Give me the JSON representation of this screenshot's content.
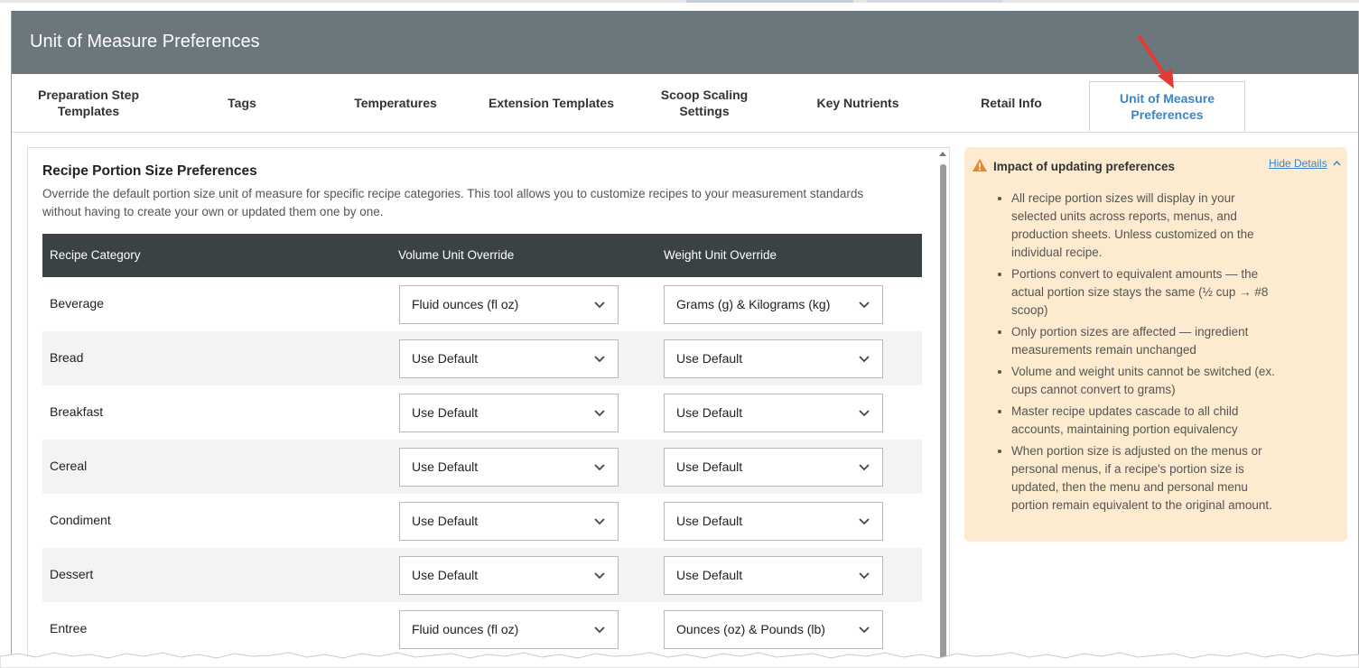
{
  "header": {
    "title": "Unit of Measure Preferences"
  },
  "tabs": [
    {
      "label": "Preparation Step Templates",
      "active": false
    },
    {
      "label": "Tags",
      "active": false
    },
    {
      "label": "Temperatures",
      "active": false
    },
    {
      "label": "Extension Templates",
      "active": false
    },
    {
      "label": "Scoop Scaling Settings",
      "active": false
    },
    {
      "label": "Key Nutrients",
      "active": false
    },
    {
      "label": "Retail Info",
      "active": false
    },
    {
      "label": "Unit of Measure Preferences",
      "active": true
    }
  ],
  "section": {
    "title": "Recipe Portion Size Preferences",
    "description": "Override the default portion size unit of measure for specific recipe categories. This tool allows you to customize recipes to your measurement standards without having to create your own or updated them one by one."
  },
  "table": {
    "columns": [
      "Recipe Category",
      "Volume Unit Override",
      "Weight Unit Override"
    ],
    "rows": [
      {
        "category": "Beverage",
        "volume": "Fluid ounces (fl oz)",
        "weight": "Grams (g) & Kilograms (kg)"
      },
      {
        "category": "Bread",
        "volume": "Use Default",
        "weight": "Use Default"
      },
      {
        "category": "Breakfast",
        "volume": "Use Default",
        "weight": "Use Default"
      },
      {
        "category": "Cereal",
        "volume": "Use Default",
        "weight": "Use Default"
      },
      {
        "category": "Condiment",
        "volume": "Use Default",
        "weight": "Use Default"
      },
      {
        "category": "Dessert",
        "volume": "Use Default",
        "weight": "Use Default"
      },
      {
        "category": "Entree",
        "volume": "Fluid ounces (fl oz)",
        "weight": "Ounces (oz) & Pounds (lb)"
      }
    ]
  },
  "info": {
    "title": "Impact of updating preferences",
    "hide_label": "Hide Details",
    "items": [
      "All recipe portion sizes will display in your selected units across reports, menus, and production sheets. Unless customized on the individual recipe.",
      "Portions convert to equivalent amounts — the actual portion size stays the same (½ cup → #8 scoop)",
      "Only portion sizes are affected — ingredient measurements remain unchanged",
      "Volume and weight units cannot be switched (ex. cups cannot convert to grams)",
      "Master recipe updates cascade to all child accounts, maintaining portion equivalency",
      "When portion size is adjusted on the menus or personal menus, if a recipe's portion size is updated, then the menu and personal menu portion remain equivalent to the original amount."
    ]
  },
  "colors": {
    "header_bg": "#6b777c",
    "accent": "#3a86c8",
    "table_header_bg": "#3b4246",
    "info_bg": "#fdebcf",
    "warning": "#e8862a",
    "annotation_arrow": "#e53935"
  },
  "icons": {
    "dropdown": "chevron-down-icon",
    "warning": "warning-triangle-icon",
    "collapse": "chevron-up-icon",
    "annotation": "red-arrow-icon"
  }
}
